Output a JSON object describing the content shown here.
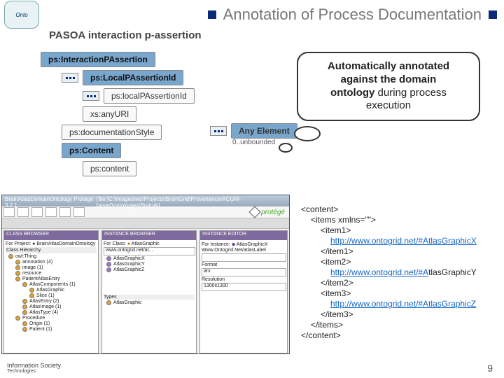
{
  "header": {
    "logo_text": "Onto",
    "title": "Annotation of Process Documentation"
  },
  "subheader": "PASOA interaction p-assertion",
  "schema": {
    "root": "ps:InteractionPAssertion",
    "local_id": "ps:LocalPAssertionId",
    "local_id_child": "ps:localPAssertionId",
    "any_uri": "xs:anyURI",
    "doc_style": "ps:documentationStyle",
    "content_grp": "ps:Content",
    "content": "ps:content",
    "any_elem": "Any Element",
    "cardinality": "0..unbounded"
  },
  "callout": {
    "l1": "Automatically annotated",
    "l2_b1": "against the ",
    "l2_b2": "domain",
    "l3_b1": "ontology",
    "l3_b2": " during process",
    "l4": "execution"
  },
  "protege": {
    "window_title_left": "BrainAtlasDomainOntology  Protégé 3.2.1",
    "window_title_right": "(file:\\C:\\images\\ws\\Projects\\BrainGrid\\Provenance\\ACGM-based\\ontologies\\BrainAtl...",
    "brand": "protégé",
    "left_pane": "CLASS BROWSER",
    "left_label": "For Project:",
    "left_value": "BrainAtlasDomainOntology",
    "left_section": "Class Hierarchy",
    "tree": [
      {
        "lvl": 0,
        "t": "owl:Thing"
      },
      {
        "lvl": 1,
        "t": "annotation (4)"
      },
      {
        "lvl": 1,
        "t": "image (1)"
      },
      {
        "lvl": 1,
        "t": "resource"
      },
      {
        "lvl": 1,
        "t": "PatientAtlasEntry"
      },
      {
        "lvl": 2,
        "t": "AtlasComponents (1)"
      },
      {
        "lvl": 3,
        "t": "AtlasGraphic"
      },
      {
        "lvl": 3,
        "t": "Slice (1)"
      },
      {
        "lvl": 2,
        "t": "AtlasEntry (2)"
      },
      {
        "lvl": 2,
        "t": "AtlasImage (1)"
      },
      {
        "lvl": 2,
        "t": "AtlasType (4)"
      },
      {
        "lvl": 1,
        "t": "Procedure"
      },
      {
        "lvl": 2,
        "t": "Origin (1)"
      },
      {
        "lvl": 2,
        "t": "Patient (1)"
      }
    ],
    "mid_pane": "INSTANCE BROWSER",
    "mid_label": "For Class:",
    "mid_value": "AtlasGraphic",
    "mid_url": "www.ontogrid.net/at...",
    "mid_items": [
      "AtlasGraphicX",
      "AtlasGraphicY",
      "AtlasGraphicZ"
    ],
    "mid_types_label": "Types",
    "mid_type": "AtlasGraphic",
    "right_pane": "INSTANCE EDITOR",
    "right_label": "For Instance:",
    "right_value": "AtlasGraphicX",
    "r_field1": "Www.Ontogrid.Net/atlasLabel",
    "r_field2": "Format",
    "r_val2": "arx",
    "r_field3": "Resolution",
    "r_val3": "1300x1300"
  },
  "xml": {
    "open_content": "<content>",
    "open_items": "<items xmlns=\"\">",
    "open_i1": "<item1>",
    "link1": "http://www.ontogrid.net/#AtlasGraphicX",
    "close_i1": "</item1>",
    "open_i2": "<item2>",
    "link2_a": "http://www.ontogrid.net/#A",
    "link2_b": "tlasGraphicY",
    "close_i2": "</item2>",
    "open_i3": "<item3>",
    "link3": "http://www.ontogrid.net/#AtlasGraphicZ",
    "close_i3": "</item3>",
    "close_items": "</items>",
    "close_content": "</content>"
  },
  "footer": {
    "label": "Information Society",
    "sublabel": "Technologies",
    "page": "9"
  }
}
